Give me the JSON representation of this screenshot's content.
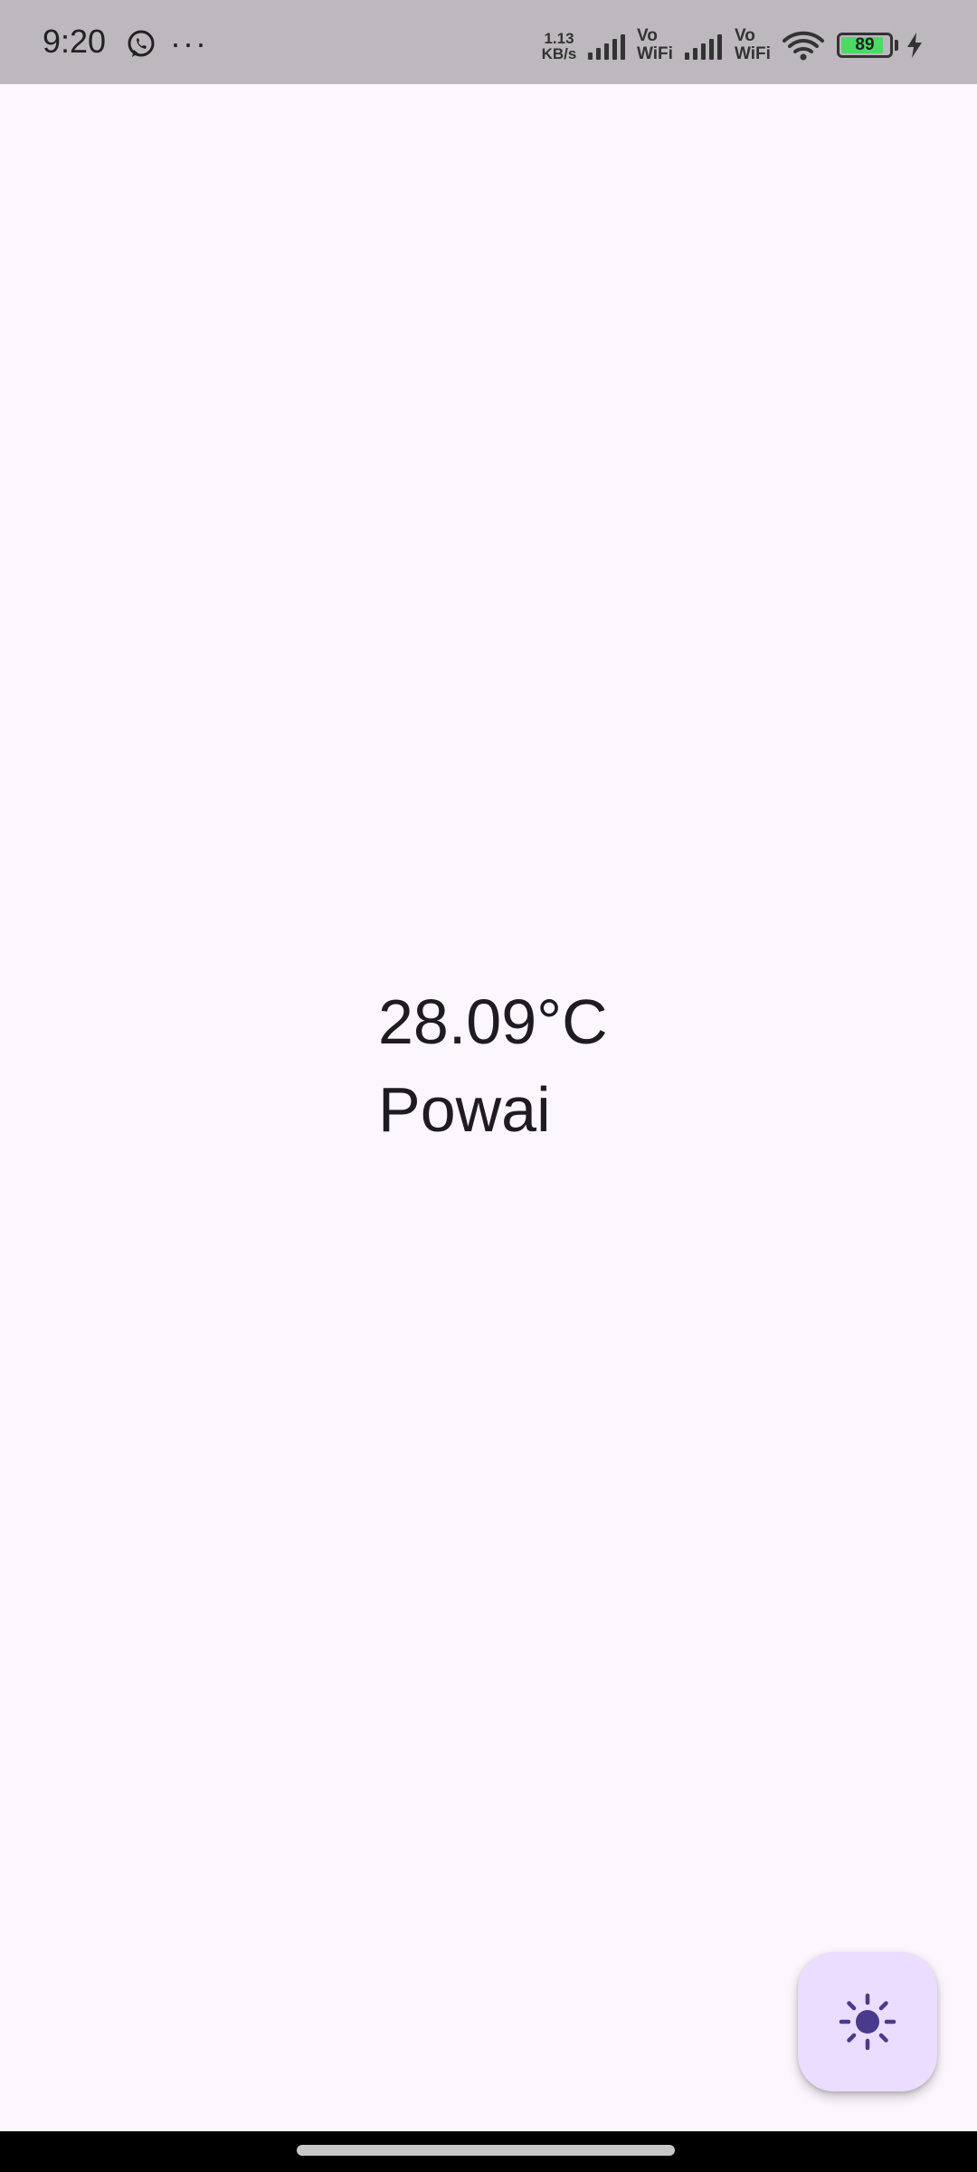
{
  "status_bar": {
    "time": "9:20",
    "notification_icons": [
      "whatsapp-icon",
      "more-dots-icon"
    ],
    "more_indicator": "···",
    "network_speed": {
      "value": "1.13",
      "unit": "KB/s"
    },
    "sim_labels": [
      {
        "line1": "Vo",
        "line2": "WiFi"
      },
      {
        "line1": "Vo",
        "line2": "WiFi"
      }
    ],
    "battery_level": "89",
    "battery_fraction": 0.89,
    "charging": true
  },
  "weather": {
    "temperature": "28.09°C",
    "location": "Powai"
  },
  "fab": {
    "icon": "sun-icon"
  },
  "colors": {
    "background": "#FCF7FD",
    "status_bar": "#BDB8BD",
    "fab_background": "#EADDFF",
    "fab_icon": "#4A3A8C",
    "text": "#1F1B22",
    "battery_fill": "#4CD964"
  }
}
